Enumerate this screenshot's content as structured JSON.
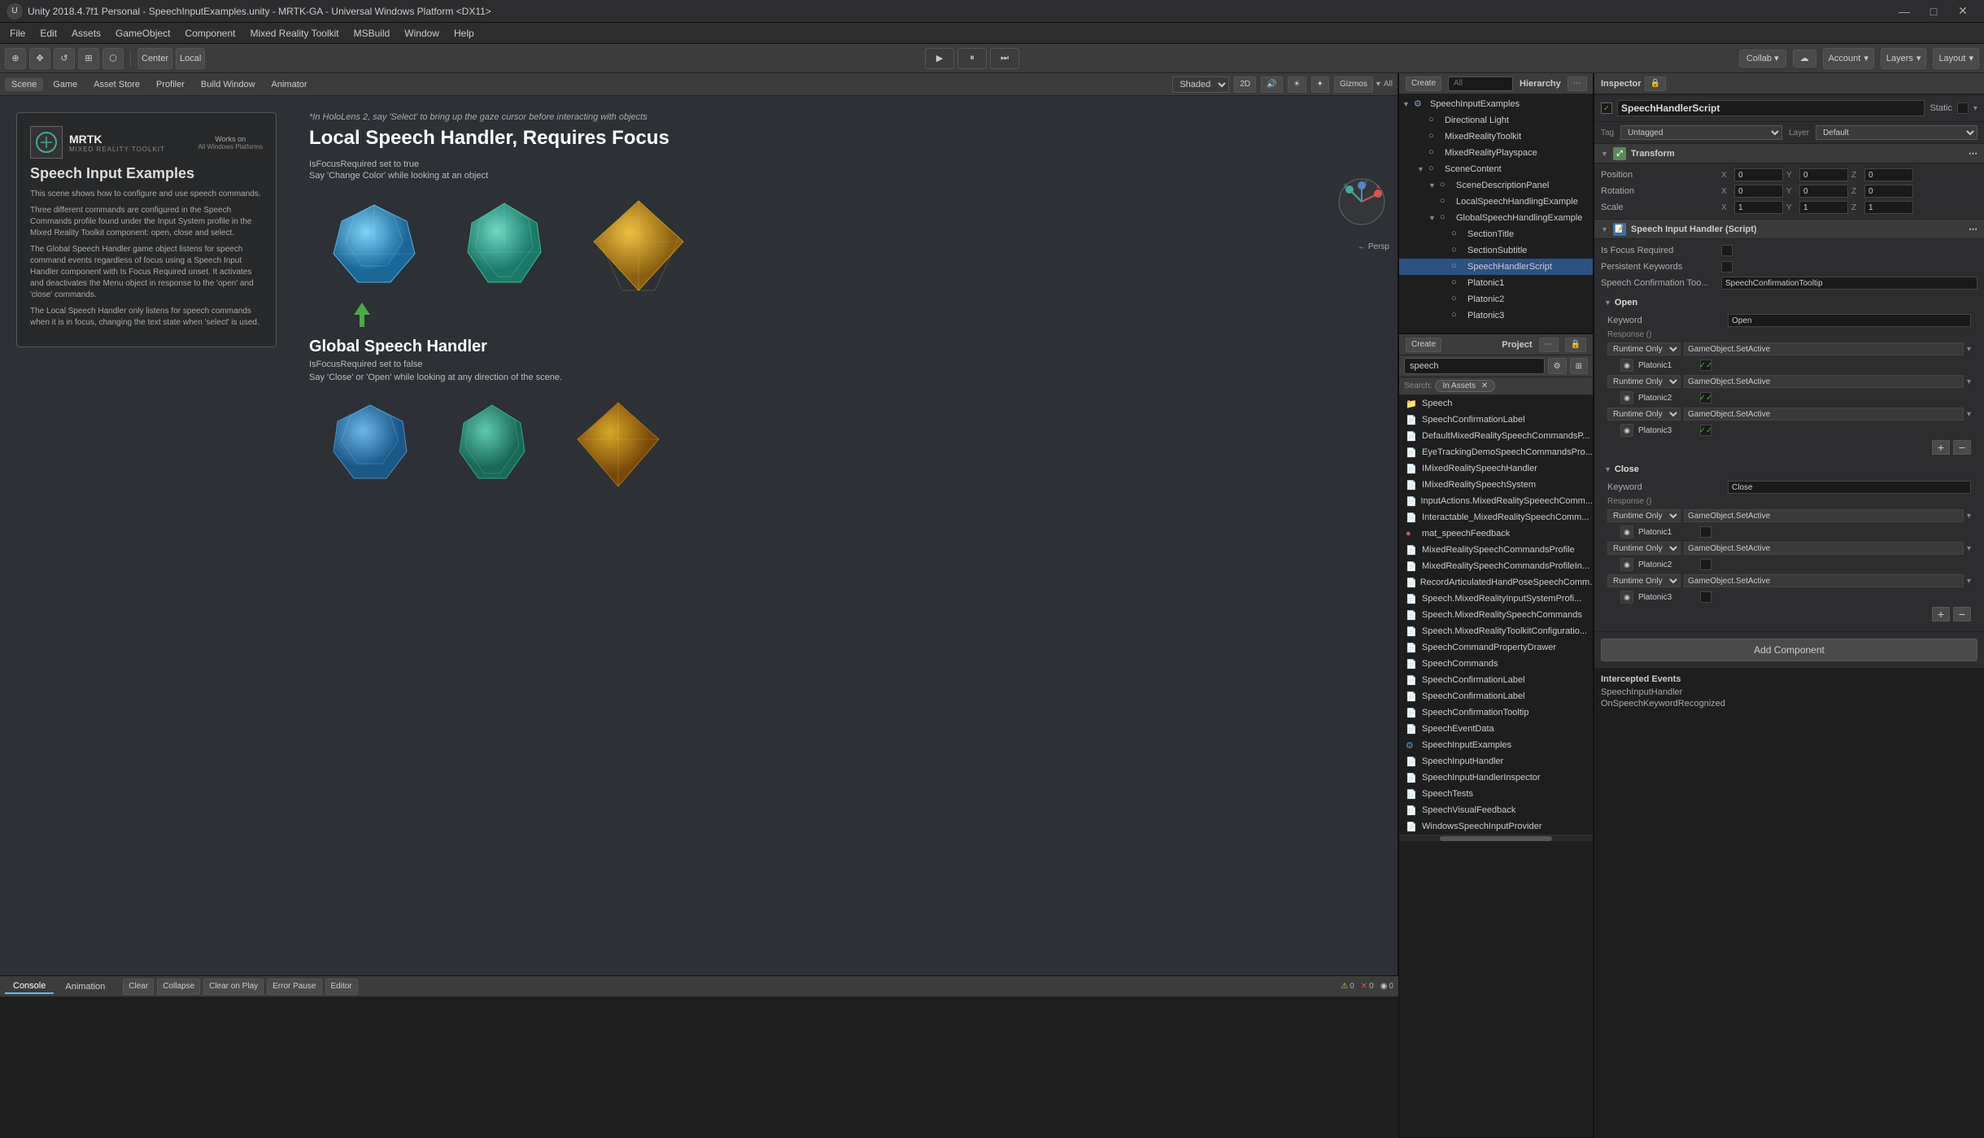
{
  "titleBar": {
    "title": "Unity 2018.4.7f1 Personal - SpeechInputExamples.unity - MRTK-GA - Universal Windows Platform <DX11>",
    "logoText": "U",
    "minimizeBtn": "—",
    "maximizeBtn": "□",
    "closeBtn": "✕"
  },
  "menuBar": {
    "items": [
      "File",
      "Edit",
      "Assets",
      "GameObject",
      "Component",
      "Mixed Reality Toolkit",
      "MSBuild",
      "Window",
      "Help"
    ]
  },
  "toolbar": {
    "tools": [
      "⊕",
      "✥",
      "↺",
      "⊞",
      "⬡"
    ],
    "center": "Center",
    "local": "Local",
    "playBtn": "▶",
    "pauseBtn": "⏸",
    "stepBtn": "⏭",
    "collab": "Collab ▾",
    "cloudBtn": "☁",
    "account": "Account",
    "layers": "Layers",
    "layout": "Layout"
  },
  "sceneTabs": {
    "tabs": [
      "Scene",
      "Game",
      "Asset Store",
      "Profiler",
      "Build Window",
      "Animator"
    ],
    "activeTab": "Scene",
    "shaded": "Shaded",
    "twod": "2D",
    "gizmos": "Gizmos",
    "all": "All"
  },
  "sceneView": {
    "infoPanel": {
      "title": "Speech Input Examples",
      "logo": "MRTK",
      "logoSub": "MIXED REALITY TOOLKIT",
      "worksOn": "Works on",
      "allWindowsPlatforms": "All Windows Platforms",
      "desc1": "This scene shows how to configure and use speech commands.",
      "desc2": "Three different commands are configured in the Speech Commands profile found under the Input System profile in the Mixed Reality Toolkit component: open, close and select.",
      "desc3": "The Global Speech Handler game object listens for speech command events regardless of focus using a Speech Input Handler component with Is Focus Required unset. It activates and deactivates the Menu object in response to the 'open' and 'close' commands.",
      "desc4": "The Local Speech Handler only listens for speech commands when it is in focus, changing the text state when 'select' is used."
    },
    "tip": "*In HoloLens 2, say 'Select' to bring up the gaze cursor before interacting with objects",
    "localTitle": "Local Speech Handler, Requires Focus",
    "localLabel1": "IsFocusRequired set to true",
    "localLabel2": "Say 'Change Color' while looking at an object",
    "globalTitle": "Global Speech Handler",
    "globalLabel1": "IsFocusRequired set to false",
    "globalLabel2": "Say 'Close' or 'Open' while looking at any direction of the scene.",
    "perspLabel": "← Persp"
  },
  "hierarchy": {
    "title": "Hierarchy",
    "createBtn": "Create",
    "searchPlaceholder": "All",
    "items": [
      {
        "label": "SpeechInputExamples",
        "depth": 0,
        "hasChildren": true,
        "icon": "scene",
        "expanded": true
      },
      {
        "label": "Directional Light",
        "depth": 1,
        "hasChildren": false,
        "icon": "obj"
      },
      {
        "label": "MixedRealityToolkit",
        "depth": 1,
        "hasChildren": false,
        "icon": "obj"
      },
      {
        "label": "MixedRealityPlayspace",
        "depth": 1,
        "hasChildren": false,
        "icon": "obj"
      },
      {
        "label": "SceneContent",
        "depth": 1,
        "hasChildren": true,
        "icon": "obj",
        "expanded": true
      },
      {
        "label": "SceneDescriptionPanel",
        "depth": 2,
        "hasChildren": true,
        "icon": "obj",
        "expanded": true,
        "selected": false
      },
      {
        "label": "LocalSpeechHandlingExample",
        "depth": 2,
        "hasChildren": false,
        "icon": "obj"
      },
      {
        "label": "GlobalSpeechHandlingExample",
        "depth": 2,
        "hasChildren": true,
        "icon": "obj",
        "expanded": true
      },
      {
        "label": "SectionTitle",
        "depth": 3,
        "hasChildren": false,
        "icon": "obj"
      },
      {
        "label": "SectionSubtitle",
        "depth": 3,
        "hasChildren": false,
        "icon": "obj"
      },
      {
        "label": "SpeechHandlerScript",
        "depth": 3,
        "hasChildren": false,
        "icon": "obj",
        "selected": true
      },
      {
        "label": "Platonic1",
        "depth": 3,
        "hasChildren": false,
        "icon": "obj"
      },
      {
        "label": "Platonic2",
        "depth": 3,
        "hasChildren": false,
        "icon": "obj"
      },
      {
        "label": "Platonic3",
        "depth": 3,
        "hasChildren": false,
        "icon": "obj"
      }
    ]
  },
  "project": {
    "title": "Project",
    "createBtn": "Create",
    "searchPlaceholder": "speech",
    "searchLabel": "Search:",
    "inAssetsLabel": "In Assets",
    "items": [
      {
        "label": "Speech",
        "icon": "folder"
      },
      {
        "label": "SpeechConfirmationLabel",
        "icon": "file"
      },
      {
        "label": "DefaultMixedRealitySpeechCommandsP...",
        "icon": "file"
      },
      {
        "label": "EyeTrackingDemoSpeechCommandsPro...",
        "icon": "file"
      },
      {
        "label": "IMixedRealitySpeechHandler",
        "icon": "file"
      },
      {
        "label": "IMixedRealitySpeechSystem",
        "icon": "file"
      },
      {
        "label": "InputActions.MixedRealitySpeeechComm...",
        "icon": "file"
      },
      {
        "label": "Interactable_MixedRealitySpeechComm...",
        "icon": "file"
      },
      {
        "label": "mat_speechFeedback",
        "icon": "material"
      },
      {
        "label": "MixedRealitySpeechCommandsProfile",
        "icon": "file"
      },
      {
        "label": "MixedRealitySpeechCommandsProfileIn...",
        "icon": "file"
      },
      {
        "label": "RecordArticulatedHandPoseSpeechComm...",
        "icon": "file"
      },
      {
        "label": "Speech.MixedRealityInputSystemProfi...",
        "icon": "file"
      },
      {
        "label": "Speech.MixedRealitySpeechCommands",
        "icon": "file"
      },
      {
        "label": "Speech.MixedRealityToolkitConfiguratio...",
        "icon": "file"
      },
      {
        "label": "SpeechCommandPropertyDrawer",
        "icon": "file"
      },
      {
        "label": "SpeechCommands",
        "icon": "file"
      },
      {
        "label": "SpeechConfirmationLabel",
        "icon": "file"
      },
      {
        "label": "SpeechConfirmationLabel",
        "icon": "file"
      },
      {
        "label": "SpeechConfirmationTooltip",
        "icon": "file"
      },
      {
        "label": "SpeechEventData",
        "icon": "file"
      },
      {
        "label": "SpeechInputExamples",
        "icon": "scene"
      },
      {
        "label": "SpeechInputHandler",
        "icon": "file"
      },
      {
        "label": "SpeechInputHandlerInspector",
        "icon": "file"
      },
      {
        "label": "SpeechTests",
        "icon": "file"
      },
      {
        "label": "SpeechVisualFeedback",
        "icon": "file"
      },
      {
        "label": "WindowsSpeechInputProvider",
        "icon": "file"
      }
    ]
  },
  "console": {
    "tabs": [
      "Console",
      "Animation"
    ],
    "activeTab": "Console",
    "clearBtn": "Clear",
    "collapseBtn": "Collapse",
    "clearOnPlayBtn": "Clear on Play",
    "errorPauseBtn": "Error Pause",
    "editorBtn": "Editor",
    "warningCount": "0",
    "errorCount": "0",
    "logCount": "0"
  },
  "inspector": {
    "title": "Inspector",
    "componentName": "SpeechHandlerScript",
    "isActiveChecked": true,
    "staticLabel": "Static",
    "tagLabel": "Tag",
    "tagValue": "Untagged",
    "layerLabel": "Layer",
    "layerValue": "Default",
    "transform": {
      "title": "Transform",
      "position": {
        "label": "Position",
        "x": "0",
        "y": "0",
        "z": "0"
      },
      "rotation": {
        "label": "Rotation",
        "x": "0",
        "y": "0",
        "z": "0"
      },
      "scale": {
        "label": "Scale",
        "x": "1",
        "y": "1",
        "z": "1"
      }
    },
    "speechInputHandler": {
      "title": "Speech Input Handler (Script)",
      "isFocusRequired": "Is Focus Required",
      "persistentKeywords": "Persistent Keywords",
      "speechConfirmationTool": "Speech Confirmation Too...",
      "speechConfirmationValue": "SpeechConfirmationTooltip",
      "openSection": {
        "label": "Open",
        "keywordLabel": "Keyword",
        "keywordValue": "Open",
        "responseLabel": "Response ()",
        "rows": [
          {
            "dropdown": "Runtime Only",
            "value": "GameObject.SetActive",
            "objName": "Platonic1",
            "checked": true
          },
          {
            "dropdown": "Runtime Only",
            "value": "GameObject.SetActive",
            "objName": "Platonic2",
            "checked": true
          },
          {
            "dropdown": "Runtime Only",
            "value": "GameObject.SetActive",
            "objName": "Platonic3",
            "checked": true
          }
        ]
      },
      "closeSection": {
        "label": "Close",
        "keywordLabel": "Keyword",
        "keywordValue": "Close",
        "responseLabel": "Response ()",
        "rows": [
          {
            "dropdown": "Runtime Only",
            "value": "GameObject.SetActive",
            "objName": "Platonic1",
            "checked": false
          },
          {
            "dropdown": "Runtime Only",
            "value": "GameObject.SetActive",
            "objName": "Platonic2",
            "checked": false
          },
          {
            "dropdown": "Runtime Only",
            "value": "GameObject.SetActive",
            "objName": "Platonic3",
            "checked": false
          }
        ]
      },
      "addComponentLabel": "Add Component"
    },
    "interceptedEvents": {
      "title": "Intercepted Events",
      "handlerLabel": "SpeechInputHandler",
      "eventLabel": "OnSpeechKeywordRecognized"
    }
  }
}
